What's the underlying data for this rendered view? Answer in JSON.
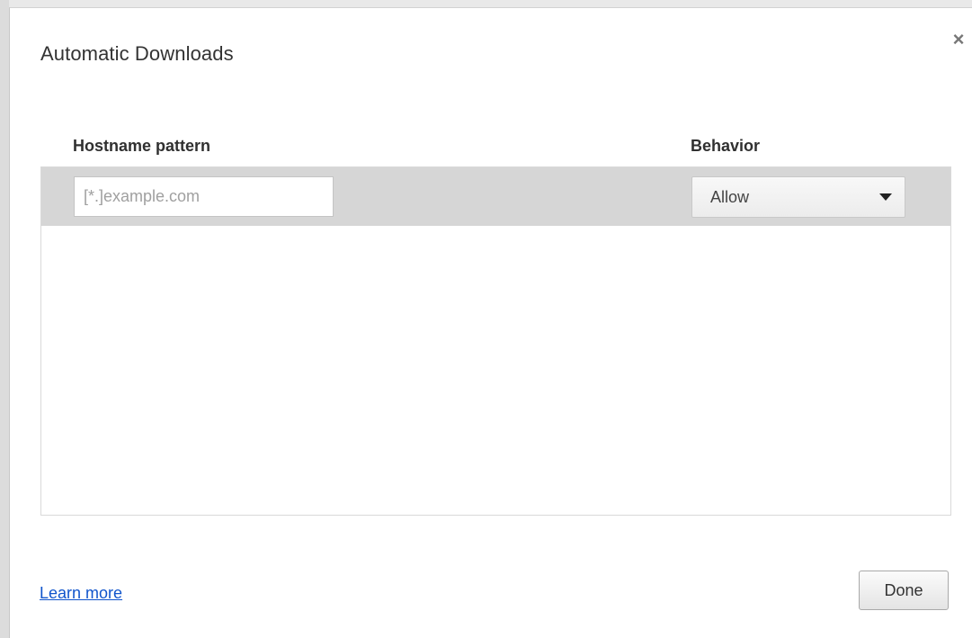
{
  "dialog": {
    "title": "Automatic Downloads",
    "close_label": "×"
  },
  "table": {
    "headers": {
      "hostname": "Hostname pattern",
      "behavior": "Behavior"
    },
    "new_entry": {
      "hostname_value": "",
      "hostname_placeholder": "[*.]example.com",
      "behavior_selected": "Allow"
    },
    "rows": []
  },
  "footer": {
    "learn_more": "Learn more",
    "done": "Done"
  },
  "icons": {
    "close": "close-icon",
    "dropdown": "chevron-down-icon"
  },
  "colors": {
    "link": "#1155cc",
    "row_highlight": "#d6d6d6"
  }
}
